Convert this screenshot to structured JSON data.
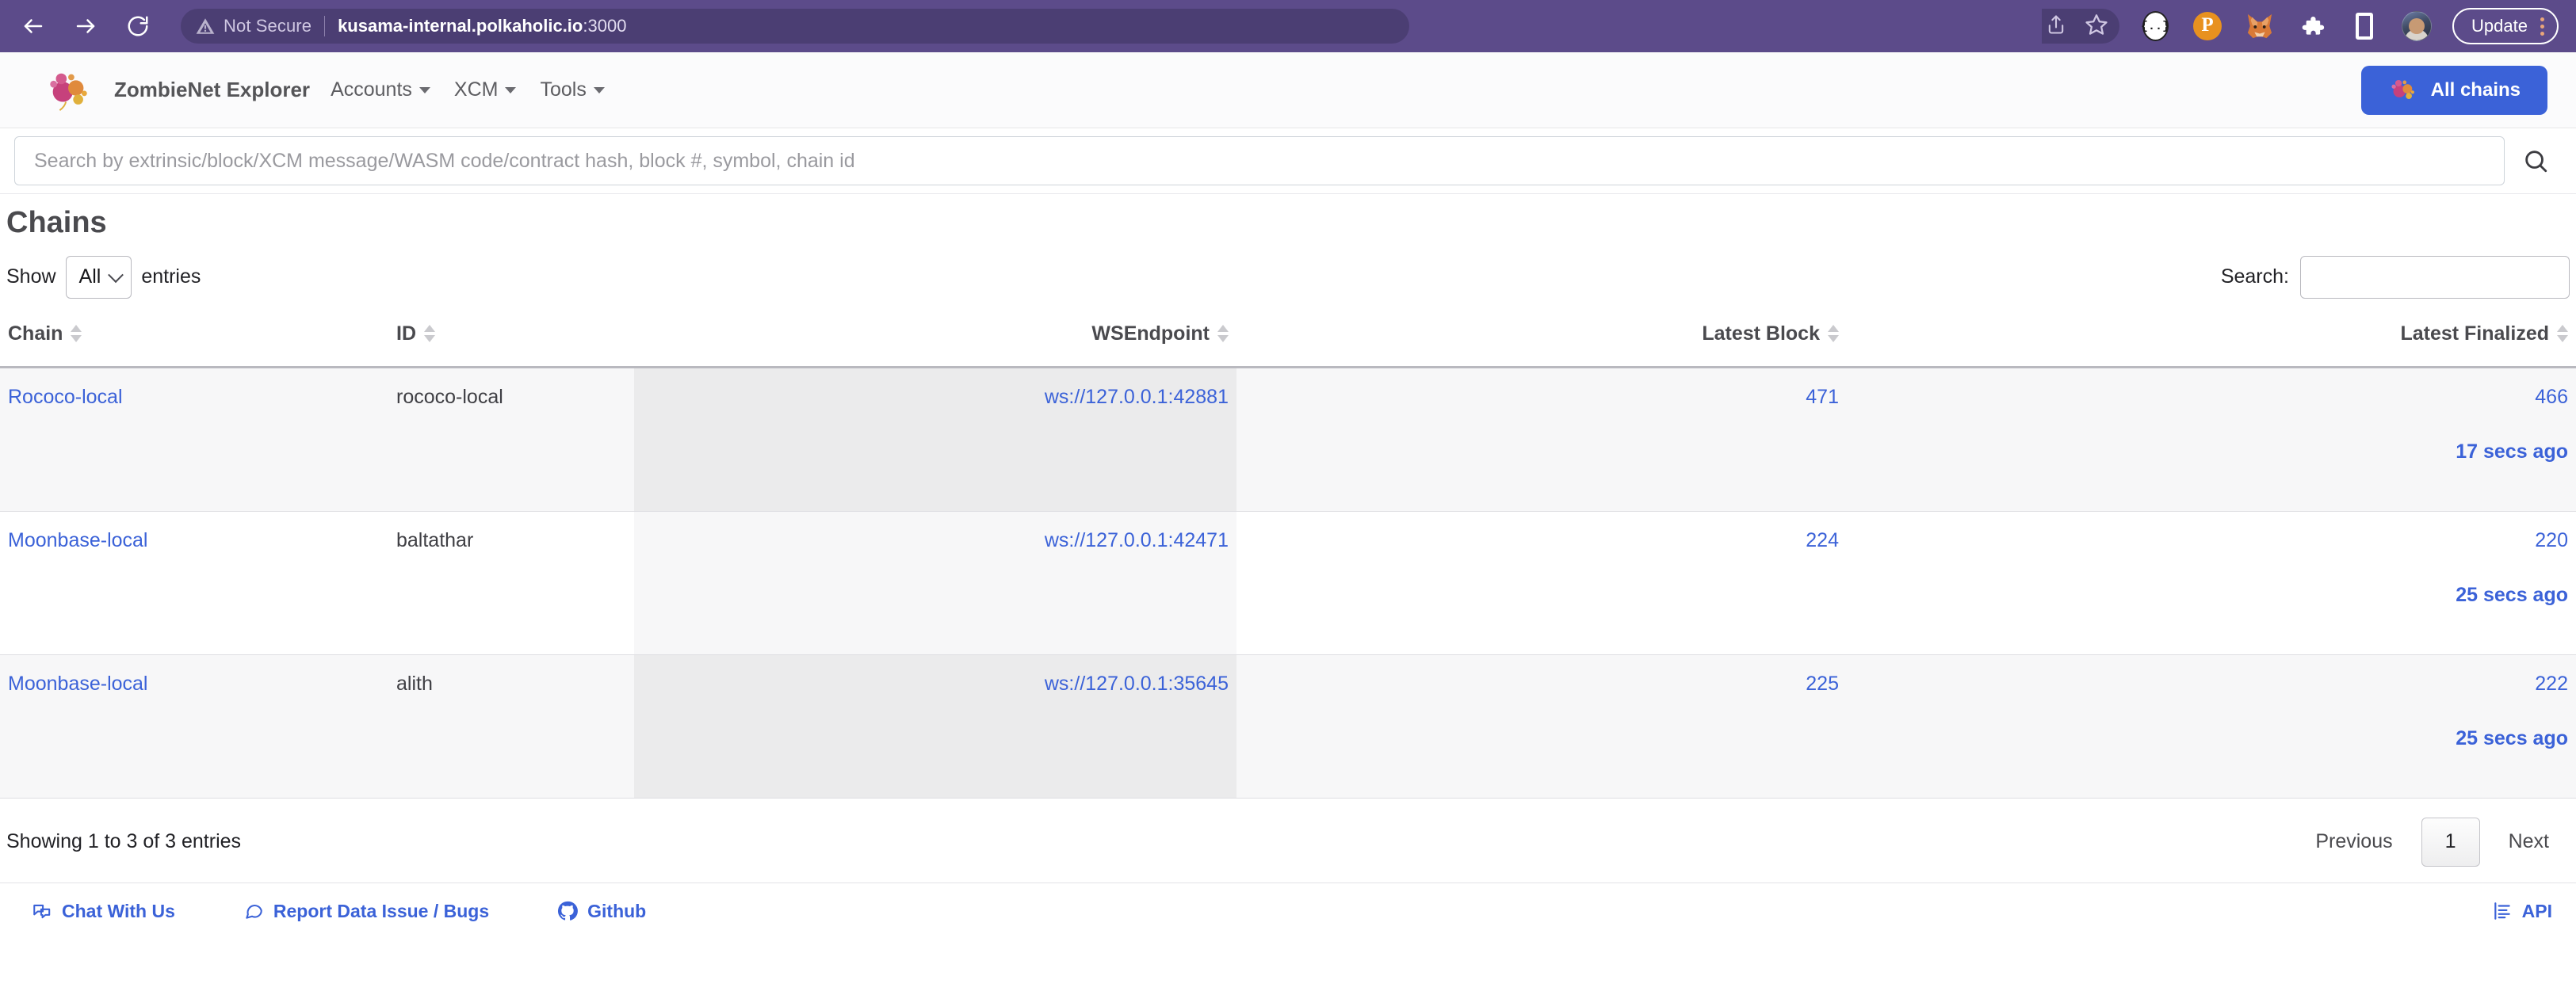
{
  "browser": {
    "back_icon": "back-arrow-icon",
    "forward_icon": "forward-arrow-icon",
    "reload_icon": "reload-icon",
    "security_label": "Not Secure",
    "url_host": "kusama-internal.polkaholic.io",
    "url_port": ":3000",
    "share_icon": "share-icon",
    "bookmark_icon": "star-icon",
    "extensions": [
      {
        "name": "json-formatter-extension-icon",
        "glyph": "{..}"
      },
      {
        "name": "polkadot-extension-icon",
        "glyph": "P"
      },
      {
        "name": "metamask-extension-icon",
        "glyph": "🦊"
      },
      {
        "name": "extensions-puzzle-icon",
        "glyph": "🧩"
      },
      {
        "name": "sidebar-toggle-icon",
        "glyph": ""
      }
    ],
    "profile_icon": "profile-avatar",
    "update_label": "Update",
    "menu_icon": "kebab-menu-icon"
  },
  "header": {
    "logo": "polkaholic-logo",
    "brand": "ZombieNet Explorer",
    "nav": [
      {
        "label": "Accounts",
        "name": "nav-accounts"
      },
      {
        "label": "XCM",
        "name": "nav-xcm"
      },
      {
        "label": "Tools",
        "name": "nav-tools"
      }
    ],
    "all_chains_label": "All chains",
    "accent_blue": "#3b62d8",
    "chrome_purple": "#5c4b8a"
  },
  "search": {
    "placeholder": "Search by extrinsic/block/XCM message/WASM code/contract hash, block #, symbol, chain id",
    "value": "",
    "icon": "search-icon"
  },
  "main": {
    "title": "Chains",
    "show_label": "Show",
    "entries_label": "entries",
    "entries_value": "All",
    "entries_options": [
      "All"
    ],
    "search_label": "Search:",
    "search_value": "",
    "columns": [
      {
        "label": "Chain",
        "name": "col-chain"
      },
      {
        "label": "ID",
        "name": "col-id"
      },
      {
        "label": "WSEndpoint",
        "name": "col-wsendpoint"
      },
      {
        "label": "Latest Block",
        "name": "col-latest-block"
      },
      {
        "label": "Latest Finalized",
        "name": "col-latest-finalized"
      }
    ],
    "rows": [
      {
        "chain": "Rococo-local",
        "id": "rococo-local",
        "wsendpoint": "ws://127.0.0.1:42881",
        "latest_block": "471",
        "latest_finalized": "466",
        "finalized_ago": "17 secs ago"
      },
      {
        "chain": "Moonbase-local",
        "id": "baltathar",
        "wsendpoint": "ws://127.0.0.1:42471",
        "latest_block": "224",
        "latest_finalized": "220",
        "finalized_ago": "25 secs ago"
      },
      {
        "chain": "Moonbase-local",
        "id": "alith",
        "wsendpoint": "ws://127.0.0.1:35645",
        "latest_block": "225",
        "latest_finalized": "222",
        "finalized_ago": "25 secs ago"
      }
    ],
    "showing_text": "Showing 1 to 3 of 3 entries",
    "pagination": {
      "previous": "Previous",
      "current_page": "1",
      "next": "Next"
    }
  },
  "footer": {
    "links": [
      {
        "label": "Chat With Us",
        "icon": "chat-bubbles-icon",
        "name": "footer-link-chat"
      },
      {
        "label": "Report Data Issue / Bugs",
        "icon": "comment-bubble-icon",
        "name": "footer-link-report"
      },
      {
        "label": "Github",
        "icon": "github-icon",
        "name": "footer-link-github"
      }
    ],
    "api_label": "API",
    "api_icon": "api-doc-icon"
  }
}
